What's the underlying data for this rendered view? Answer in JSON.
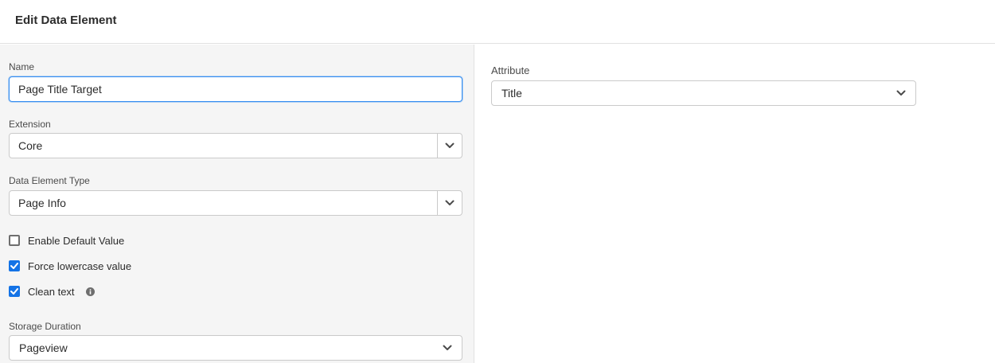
{
  "header": {
    "title": "Edit Data Element"
  },
  "form": {
    "name": {
      "label": "Name",
      "value": "Page Title Target"
    },
    "extension": {
      "label": "Extension",
      "value": "Core"
    },
    "data_element_type": {
      "label": "Data Element Type",
      "value": "Page Info"
    },
    "checkboxes": [
      {
        "label": "Enable Default Value",
        "checked": false
      },
      {
        "label": "Force lowercase value",
        "checked": true
      },
      {
        "label": "Clean text",
        "checked": true,
        "info_icon": "info-icon"
      }
    ],
    "storage_duration": {
      "label": "Storage Duration",
      "value": "Pageview"
    }
  },
  "attribute": {
    "label": "Attribute",
    "value": "Title"
  },
  "colors": {
    "accent": "#1473e6",
    "focus_border": "#378ef0",
    "left_panel_bg": "#f5f5f5",
    "border": "#cacaca"
  }
}
